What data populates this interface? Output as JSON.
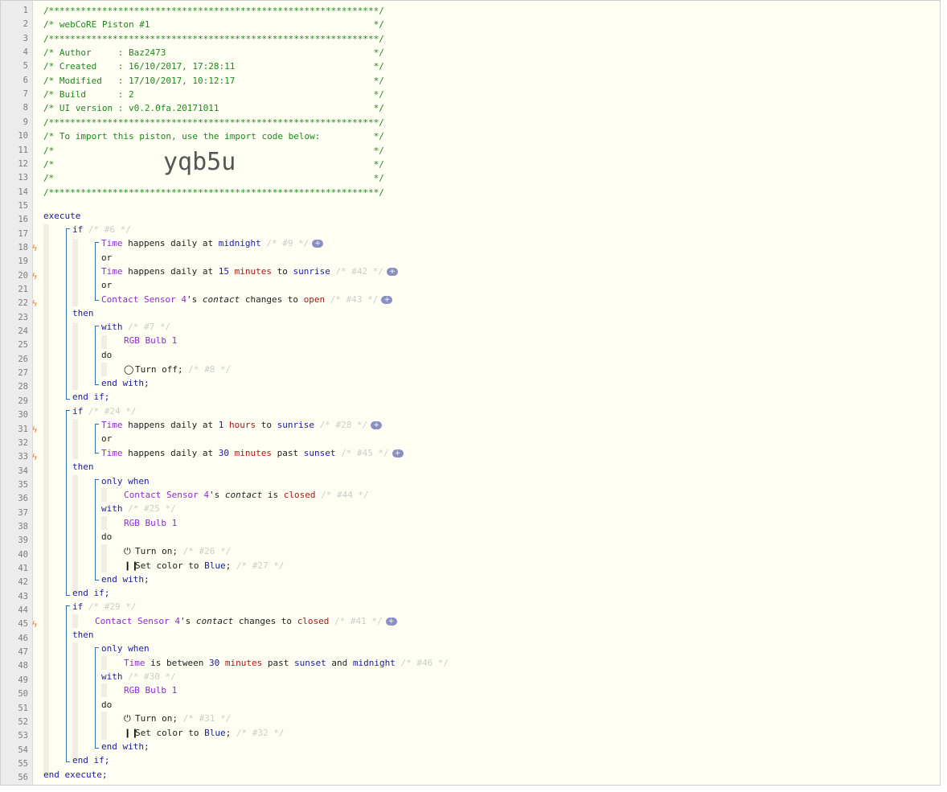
{
  "header_comments": [
    "/**************************************************************/",
    "/* webCoRE Piston #1                                          */",
    "/**************************************************************/",
    "/* Author     : Baz2473                                       */",
    "/* Created    : 16/10/2017, 17:28:11                          */",
    "/* Modified   : 17/10/2017, 10:12:17                          */",
    "/* Build      : 2                                             */",
    "/* UI version : v0.2.0fa.20171011                             */",
    "/**************************************************************/",
    "/* To import this piston, use the import code below:          */",
    "/*                                                            */",
    "/*                                                            */",
    "/*                                                            */",
    "/**************************************************************/"
  ],
  "import_code": "yqb5u",
  "line_numbers": [
    "1",
    "2",
    "3",
    "4",
    "5",
    "6",
    "7",
    "8",
    "9",
    "10",
    "11",
    "12",
    "13",
    "14",
    "15",
    "16",
    "17",
    "18",
    "19",
    "20",
    "21",
    "22",
    "23",
    "24",
    "25",
    "26",
    "27",
    "28",
    "29",
    "30",
    "31",
    "32",
    "33",
    "34",
    "35",
    "36",
    "37",
    "38",
    "39",
    "40",
    "41",
    "42",
    "43",
    "44",
    "45",
    "46",
    "47",
    "48",
    "49",
    "50",
    "51",
    "52",
    "53",
    "54",
    "55",
    "56"
  ],
  "kw": {
    "execute": "execute",
    "end_execute": "end execute;",
    "if": "if",
    "or": "or",
    "then": "then",
    "with": "with",
    "do": "do",
    "end_with": "end with;",
    "end_if": "end if;",
    "only_when": "only when",
    "and": "and"
  },
  "words": {
    "time": "Time",
    "happens_daily_at": "happens daily at",
    "midnight": "midnight",
    "to": "to",
    "past": "past",
    "sunrise": "sunrise",
    "sunset": "sunset",
    "minutes": "minutes",
    "hours": "hours",
    "contact_sensor": "Contact Sensor 4",
    "apos_s": "'s",
    "contact": "contact",
    "changes_to": "changes to",
    "is": "is",
    "is_between": "is between",
    "open": "open",
    "closed": "closed",
    "rgb_bulb": "RGB Bulb 1",
    "turn_off": "Turn off;",
    "turn_on": "Turn on;",
    "set_color_to": "Set color to",
    "blue": "Blue",
    "semicolon": ";",
    "n15": "15",
    "n1": "1",
    "n30": "30",
    "plus": "+"
  },
  "ids": {
    "s6": "/* #6 */",
    "s9": "/* #9 */",
    "s42": "/* #42 */",
    "s43": "/* #43 */",
    "s7": "/* #7 */",
    "s8": "/* #8 */",
    "s24": "/* #24 */",
    "s28": "/* #28 */",
    "s45": "/* #45 */",
    "s44": "/* #44 */",
    "s25": "/* #25 */",
    "s26": "/* #26 */",
    "s27": "/* #27 */",
    "s29": "/* #29 */",
    "s41": "/* #41 */",
    "s46": "/* #46 */",
    "s30": "/* #30 */",
    "s31": "/* #31 */",
    "s32": "/* #32 */"
  },
  "colors": {
    "keyword": "#1a1aa8",
    "device": "#8e2bd1",
    "value": "#b31515",
    "comment": "#1b8a1b",
    "trigger_bolt": "#f07b2c"
  }
}
